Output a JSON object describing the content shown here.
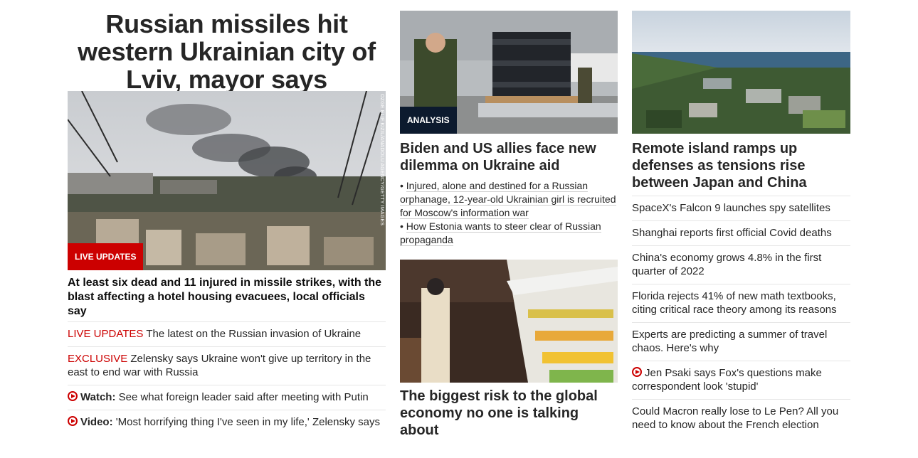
{
  "lead": {
    "headline": "Russian missiles hit western Ukrainian city of Lviv, mayor says",
    "badge": "LIVE UPDATES",
    "photo_credit": "OZGE ELIF KIZIL/ANADOLU AGENCY/GETTY IMAGES",
    "subhead": "At least six dead and 11 injured in missile strikes, with the blast affecting a hotel housing evacuees, local officials say",
    "links": [
      {
        "label": "LIVE UPDATES",
        "text": " The latest on the Russian invasion of Ukraine"
      },
      {
        "label": "EXCLUSIVE",
        "text": " Zelensky says Ukraine won't give up territory in the east to end war with Russia"
      },
      {
        "label": "Watch:",
        "text": " See what foreign leader said after meeting with Putin"
      },
      {
        "label": "Video:",
        "text": " 'Most horrifying thing I've seen in my life,' Zelensky says"
      }
    ]
  },
  "middle": {
    "story1": {
      "badge": "ANALYSIS",
      "title": "Biden and US allies face new dilemma on Ukraine aid",
      "bullets": [
        "Injured, alone and destined for a Russian orphanage, 12-year-old Ukrainian girl is recruited for Moscow's information war",
        "How Estonia wants to steer clear of Russian propaganda"
      ]
    },
    "story2": {
      "title": "The biggest risk to the global economy no one is talking about"
    }
  },
  "right": {
    "title": "Remote island ramps up defenses as tensions rise between Japan and China",
    "links": [
      {
        "text": "SpaceX's Falcon 9 launches spy satellites",
        "video": false
      },
      {
        "text": "Shanghai reports first official Covid deaths",
        "video": false
      },
      {
        "text": "China's economy grows 4.8% in the first quarter of 2022",
        "video": false
      },
      {
        "text": "Florida rejects 41% of new math textbooks, citing critical race theory among its reasons",
        "video": false
      },
      {
        "text": "Experts are predicting a summer of travel chaos. Here's why",
        "video": false
      },
      {
        "text": "Jen Psaki says Fox's questions make correspondent look 'stupid'",
        "video": true
      },
      {
        "text": "Could Macron really lose to Le Pen? All you need to know about the French election",
        "video": false
      }
    ]
  },
  "colors": {
    "accent_red": "#cc0000",
    "analysis_navy": "#0c1a2e",
    "divider": "#e6e6e6"
  }
}
